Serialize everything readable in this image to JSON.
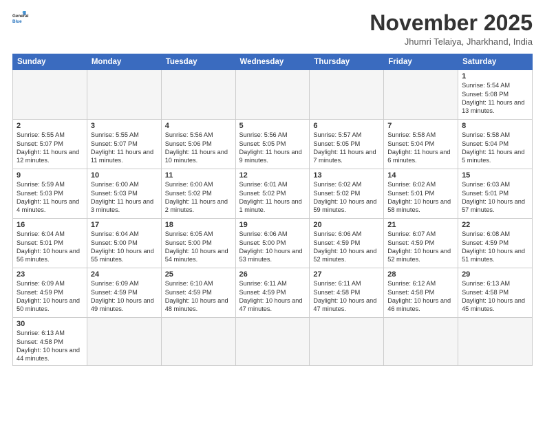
{
  "logo": {
    "line1": "General",
    "line2": "Blue"
  },
  "title": "November 2025",
  "subtitle": "Jhumri Telaiya, Jharkhand, India",
  "days_of_week": [
    "Sunday",
    "Monday",
    "Tuesday",
    "Wednesday",
    "Thursday",
    "Friday",
    "Saturday"
  ],
  "weeks": [
    [
      {
        "num": "",
        "info": ""
      },
      {
        "num": "",
        "info": ""
      },
      {
        "num": "",
        "info": ""
      },
      {
        "num": "",
        "info": ""
      },
      {
        "num": "",
        "info": ""
      },
      {
        "num": "",
        "info": ""
      },
      {
        "num": "1",
        "info": "Sunrise: 5:54 AM\nSunset: 5:08 PM\nDaylight: 11 hours\nand 13 minutes."
      }
    ],
    [
      {
        "num": "2",
        "info": "Sunrise: 5:55 AM\nSunset: 5:07 PM\nDaylight: 11 hours\nand 12 minutes."
      },
      {
        "num": "3",
        "info": "Sunrise: 5:55 AM\nSunset: 5:07 PM\nDaylight: 11 hours\nand 11 minutes."
      },
      {
        "num": "4",
        "info": "Sunrise: 5:56 AM\nSunset: 5:06 PM\nDaylight: 11 hours\nand 10 minutes."
      },
      {
        "num": "5",
        "info": "Sunrise: 5:56 AM\nSunset: 5:05 PM\nDaylight: 11 hours\nand 9 minutes."
      },
      {
        "num": "6",
        "info": "Sunrise: 5:57 AM\nSunset: 5:05 PM\nDaylight: 11 hours\nand 7 minutes."
      },
      {
        "num": "7",
        "info": "Sunrise: 5:58 AM\nSunset: 5:04 PM\nDaylight: 11 hours\nand 6 minutes."
      },
      {
        "num": "8",
        "info": "Sunrise: 5:58 AM\nSunset: 5:04 PM\nDaylight: 11 hours\nand 5 minutes."
      }
    ],
    [
      {
        "num": "9",
        "info": "Sunrise: 5:59 AM\nSunset: 5:03 PM\nDaylight: 11 hours\nand 4 minutes."
      },
      {
        "num": "10",
        "info": "Sunrise: 6:00 AM\nSunset: 5:03 PM\nDaylight: 11 hours\nand 3 minutes."
      },
      {
        "num": "11",
        "info": "Sunrise: 6:00 AM\nSunset: 5:02 PM\nDaylight: 11 hours\nand 2 minutes."
      },
      {
        "num": "12",
        "info": "Sunrise: 6:01 AM\nSunset: 5:02 PM\nDaylight: 11 hours\nand 1 minute."
      },
      {
        "num": "13",
        "info": "Sunrise: 6:02 AM\nSunset: 5:02 PM\nDaylight: 10 hours\nand 59 minutes."
      },
      {
        "num": "14",
        "info": "Sunrise: 6:02 AM\nSunset: 5:01 PM\nDaylight: 10 hours\nand 58 minutes."
      },
      {
        "num": "15",
        "info": "Sunrise: 6:03 AM\nSunset: 5:01 PM\nDaylight: 10 hours\nand 57 minutes."
      }
    ],
    [
      {
        "num": "16",
        "info": "Sunrise: 6:04 AM\nSunset: 5:01 PM\nDaylight: 10 hours\nand 56 minutes."
      },
      {
        "num": "17",
        "info": "Sunrise: 6:04 AM\nSunset: 5:00 PM\nDaylight: 10 hours\nand 55 minutes."
      },
      {
        "num": "18",
        "info": "Sunrise: 6:05 AM\nSunset: 5:00 PM\nDaylight: 10 hours\nand 54 minutes."
      },
      {
        "num": "19",
        "info": "Sunrise: 6:06 AM\nSunset: 5:00 PM\nDaylight: 10 hours\nand 53 minutes."
      },
      {
        "num": "20",
        "info": "Sunrise: 6:06 AM\nSunset: 4:59 PM\nDaylight: 10 hours\nand 52 minutes."
      },
      {
        "num": "21",
        "info": "Sunrise: 6:07 AM\nSunset: 4:59 PM\nDaylight: 10 hours\nand 52 minutes."
      },
      {
        "num": "22",
        "info": "Sunrise: 6:08 AM\nSunset: 4:59 PM\nDaylight: 10 hours\nand 51 minutes."
      }
    ],
    [
      {
        "num": "23",
        "info": "Sunrise: 6:09 AM\nSunset: 4:59 PM\nDaylight: 10 hours\nand 50 minutes."
      },
      {
        "num": "24",
        "info": "Sunrise: 6:09 AM\nSunset: 4:59 PM\nDaylight: 10 hours\nand 49 minutes."
      },
      {
        "num": "25",
        "info": "Sunrise: 6:10 AM\nSunset: 4:59 PM\nDaylight: 10 hours\nand 48 minutes."
      },
      {
        "num": "26",
        "info": "Sunrise: 6:11 AM\nSunset: 4:59 PM\nDaylight: 10 hours\nand 47 minutes."
      },
      {
        "num": "27",
        "info": "Sunrise: 6:11 AM\nSunset: 4:58 PM\nDaylight: 10 hours\nand 47 minutes."
      },
      {
        "num": "28",
        "info": "Sunrise: 6:12 AM\nSunset: 4:58 PM\nDaylight: 10 hours\nand 46 minutes."
      },
      {
        "num": "29",
        "info": "Sunrise: 6:13 AM\nSunset: 4:58 PM\nDaylight: 10 hours\nand 45 minutes."
      }
    ],
    [
      {
        "num": "30",
        "info": "Sunrise: 6:13 AM\nSunset: 4:58 PM\nDaylight: 10 hours\nand 44 minutes."
      },
      {
        "num": "",
        "info": ""
      },
      {
        "num": "",
        "info": ""
      },
      {
        "num": "",
        "info": ""
      },
      {
        "num": "",
        "info": ""
      },
      {
        "num": "",
        "info": ""
      },
      {
        "num": "",
        "info": ""
      }
    ]
  ]
}
